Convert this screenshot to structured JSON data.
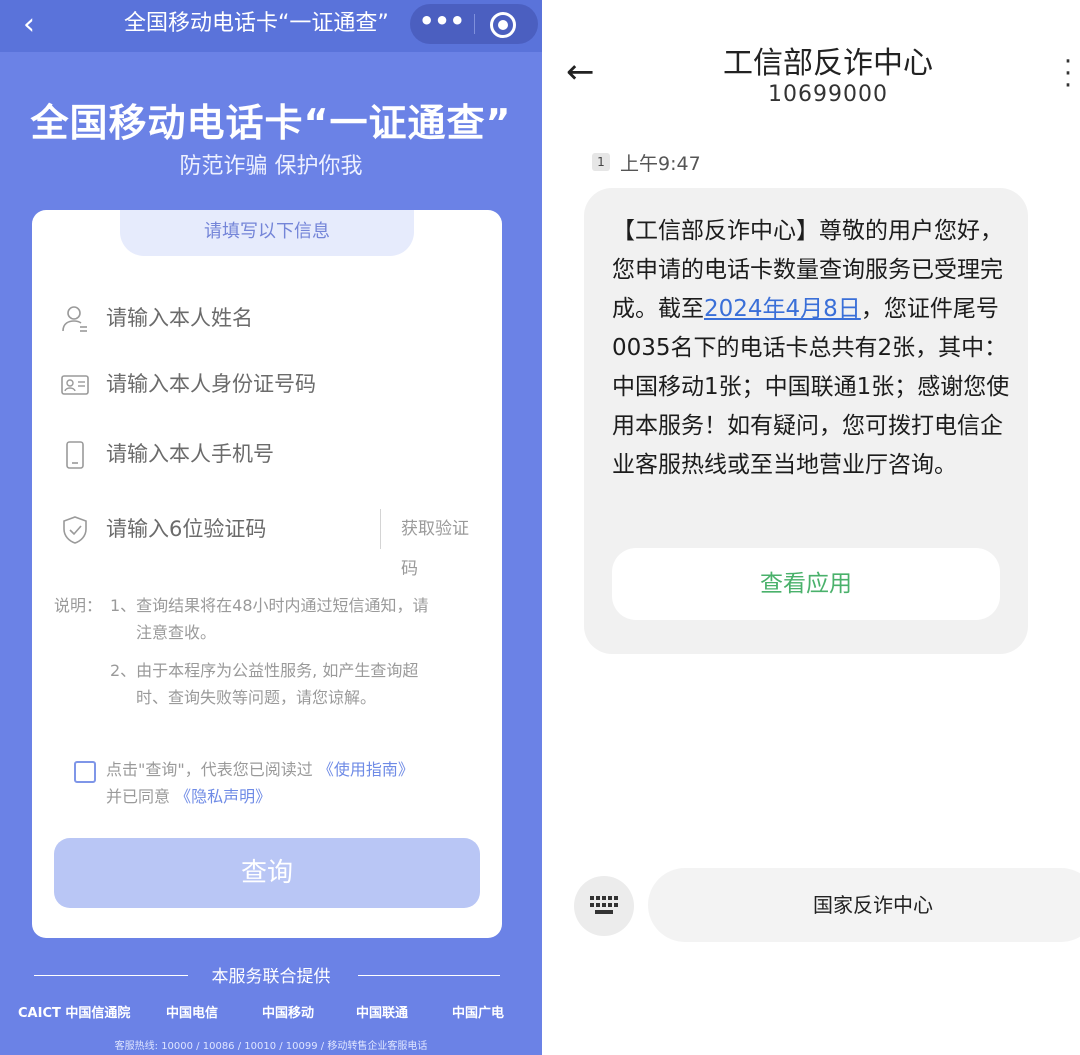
{
  "left": {
    "topbar": {
      "title": "全国移动电话卡“一证通查”"
    },
    "hero": {
      "title": "全国移动电话卡“一证通查”",
      "subtitle": "防范诈骗 保护你我"
    },
    "form": {
      "section_label": "请填写以下信息",
      "name_placeholder": "请输入本人姓名",
      "id_placeholder": "请输入本人身份证号码",
      "phone_placeholder": "请输入本人手机号",
      "code_placeholder": "请输入6位验证码",
      "get_code_label": "获取验证码",
      "note_label": "说明：",
      "note_1_line1": "1、查询结果将在48小时内通过短信通知，请",
      "note_1_line2": "注意查收。",
      "note_2_line1": "2、由于本程序为公益性服务, 如产生查询超",
      "note_2_line2": "时、查询失败等问题，请您谅解。",
      "agree_prefix": "点击\"查询\"，代表您已阅读过",
      "guide_link": "《使用指南》",
      "agree_middle": "并已同意",
      "privacy_link": "《隐私声明》",
      "query_button": "查询"
    },
    "footer": {
      "provider": "本服务联合提供",
      "logos": [
        "CAICT 中国信通院",
        "中国电信",
        "中国移动",
        "中国联通",
        "中国广电"
      ],
      "hotline": "客服热线: 10000 / 10086 / 10010 / 10099 / 移动转售企业客服电话"
    }
  },
  "right": {
    "header": {
      "title": "工信部反诈中心",
      "number": "10699000"
    },
    "message": {
      "sim": "1",
      "time": "上午9:47",
      "text_before": "【工信部反诈中心】尊敬的用户您好，您申请的电话卡数量查询服务已受理完成。截至",
      "date": "2024年4月8日",
      "text_after": "，您证件尾号0035名下的电话卡总共有2张，其中：中国移动1张；中国联通1张；感谢您使用本服务！如有疑问，您可拨打电信企业客服热线或至当地营业厅咨询。",
      "app_button": "查看应用"
    },
    "composer": {
      "text": "国家反诈中心"
    }
  }
}
